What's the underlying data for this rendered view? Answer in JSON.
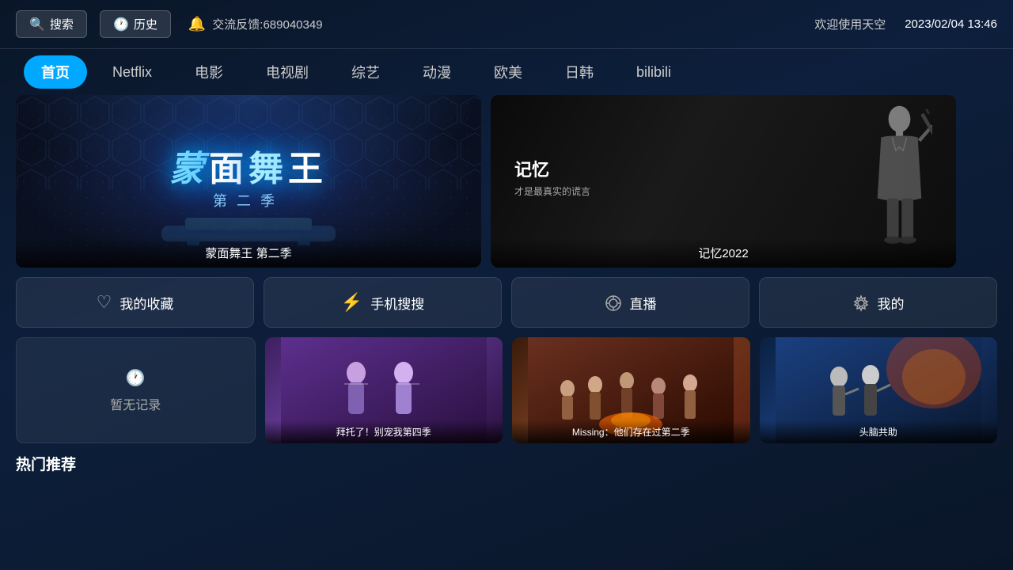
{
  "header": {
    "search_label": "搜索",
    "history_label": "历史",
    "feedback_text": "交流反馈:689040349",
    "welcome_text": "欢迎使用天空",
    "datetime": "2023/02/04 13:46"
  },
  "nav": {
    "items": [
      {
        "id": "home",
        "label": "首页",
        "active": true
      },
      {
        "id": "netflix",
        "label": "Netflix",
        "active": false
      },
      {
        "id": "movie",
        "label": "电影",
        "active": false
      },
      {
        "id": "tv",
        "label": "电视剧",
        "active": false
      },
      {
        "id": "variety",
        "label": "综艺",
        "active": false
      },
      {
        "id": "anime",
        "label": "动漫",
        "active": false
      },
      {
        "id": "europe",
        "label": "欧美",
        "active": false
      },
      {
        "id": "jp_kr",
        "label": "日韩",
        "active": false
      },
      {
        "id": "bilibili",
        "label": "bilibili",
        "active": false
      }
    ]
  },
  "hero": {
    "left": {
      "title": "蒙面舞王 第二季",
      "logo_text": "蒙面舞王",
      "subtitle": "第二季"
    },
    "right": {
      "title": "记忆2022",
      "title_cn": "记忆",
      "subtitle": "才是最真实的谎言"
    }
  },
  "quick": {
    "items": [
      {
        "id": "favorites",
        "label": "我的收藏",
        "icon": "♡"
      },
      {
        "id": "mobile_search",
        "label": "手机搜搜",
        "icon": "⚡"
      },
      {
        "id": "live",
        "label": "直播",
        "icon": "◎"
      },
      {
        "id": "mine",
        "label": "我的",
        "icon": "⚙"
      }
    ]
  },
  "recent": {
    "empty_text": "暂无记录",
    "items": [
      {
        "id": "item1",
        "title": "拜托了！别宠我第四季",
        "empty": false,
        "bg": "purple"
      },
      {
        "id": "item2",
        "title": "Missing：他们存在过第二季",
        "empty": false,
        "bg": "orange"
      },
      {
        "id": "item3",
        "title": "头脑共助",
        "empty": false,
        "bg": "blue"
      }
    ]
  },
  "section": {
    "hot_title": "热门推荐"
  }
}
